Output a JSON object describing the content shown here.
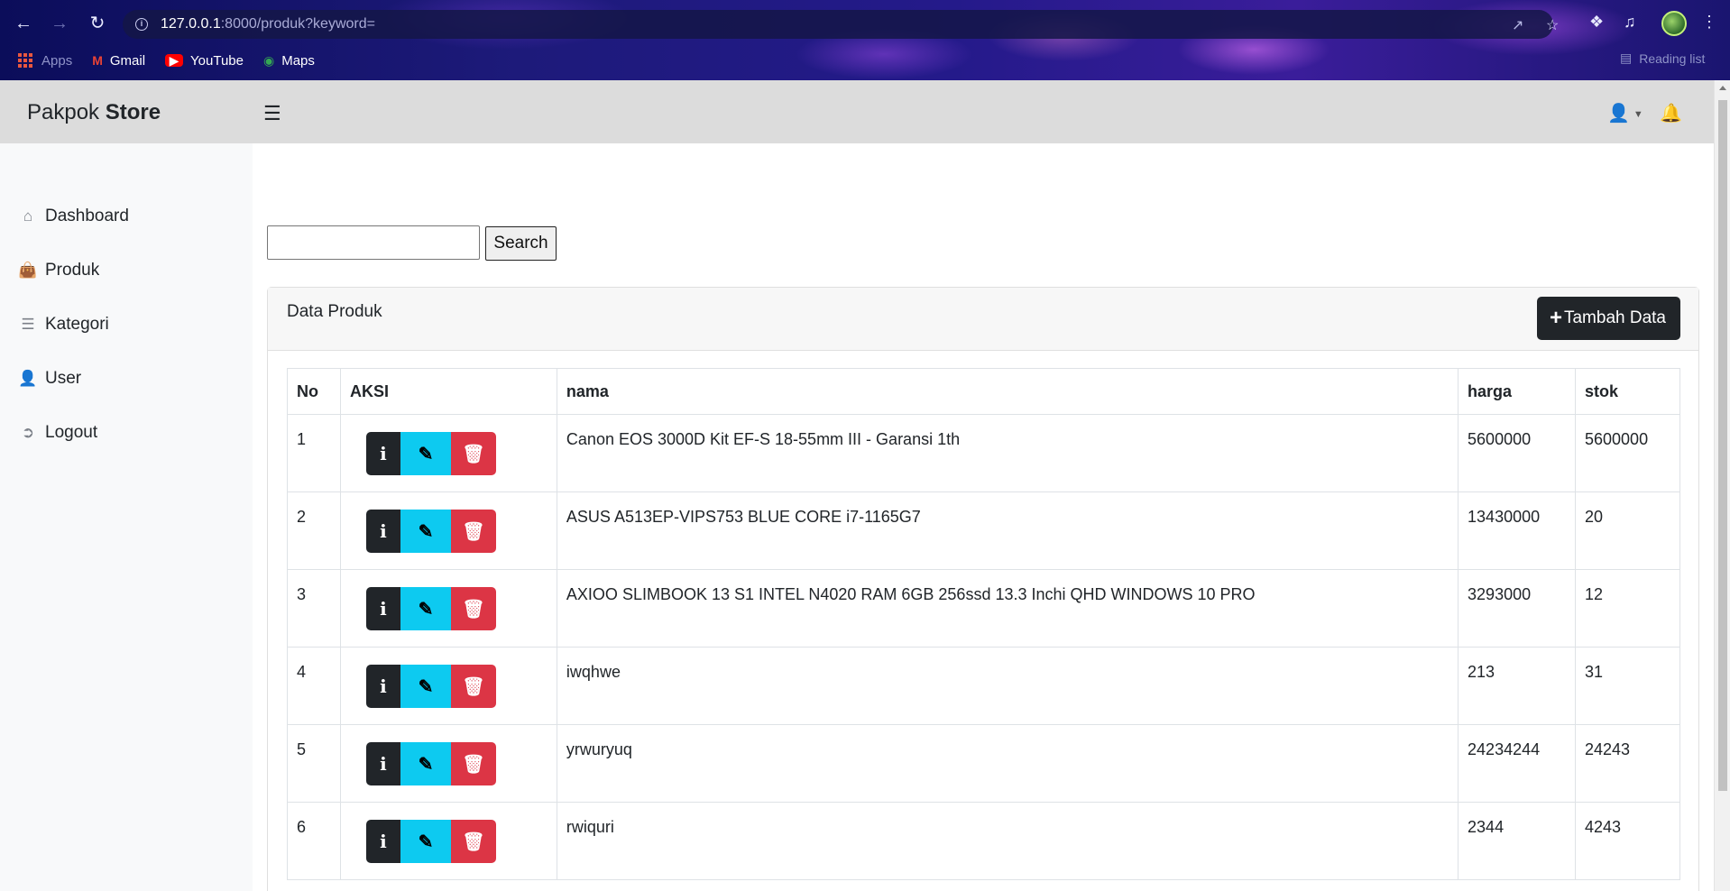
{
  "browser": {
    "url_host": "127.0.0.1",
    "url_rest": ":8000/produk?keyword=",
    "bookmarks": [
      "Apps",
      "Gmail",
      "YouTube",
      "Maps"
    ],
    "reading_list": "Reading list"
  },
  "app": {
    "brand_light": "Pakpok",
    "brand_bold": "Store"
  },
  "sidebar": {
    "items": [
      {
        "label": "Dashboard",
        "icon": "home-icon"
      },
      {
        "label": "Produk",
        "icon": "shopping-bag-icon"
      },
      {
        "label": "Kategori",
        "icon": "list-icon"
      },
      {
        "label": "User",
        "icon": "user-icon"
      },
      {
        "label": "Logout",
        "icon": "sign-out-icon"
      }
    ]
  },
  "search": {
    "value": "",
    "button_label": "Search"
  },
  "card": {
    "title": "Data Produk",
    "add_label": "Tambah Data"
  },
  "table": {
    "headers": {
      "no": "No",
      "aksi": "AKSI",
      "nama": "nama",
      "harga": "harga",
      "stok": "stok"
    },
    "rows": [
      {
        "no": "1",
        "nama": "Canon EOS 3000D Kit EF-S 18-55mm III - Garansi 1th",
        "harga": "5600000",
        "stok": "5600000"
      },
      {
        "no": "2",
        "nama": "ASUS A513EP-VIPS753 BLUE CORE i7-1165G7",
        "harga": "13430000",
        "stok": "20"
      },
      {
        "no": "3",
        "nama": "AXIOO SLIMBOOK 13 S1 INTEL N4020 RAM 6GB 256ssd 13.3 Inchi QHD WINDOWS 10 PRO",
        "harga": "3293000",
        "stok": "12"
      },
      {
        "no": "4",
        "nama": "iwqhwe",
        "harga": "213",
        "stok": "31"
      },
      {
        "no": "5",
        "nama": "yrwuryuq",
        "harga": "24234244",
        "stok": "24243"
      },
      {
        "no": "6",
        "nama": "rwiquri",
        "harga": "2344",
        "stok": "4243"
      }
    ]
  },
  "colors": {
    "topbar": "#dcdcdc",
    "sidebar": "#f8f9fa",
    "btn_dark": "#212529",
    "btn_info": "#0dcaf0",
    "btn_danger": "#dc3545"
  }
}
